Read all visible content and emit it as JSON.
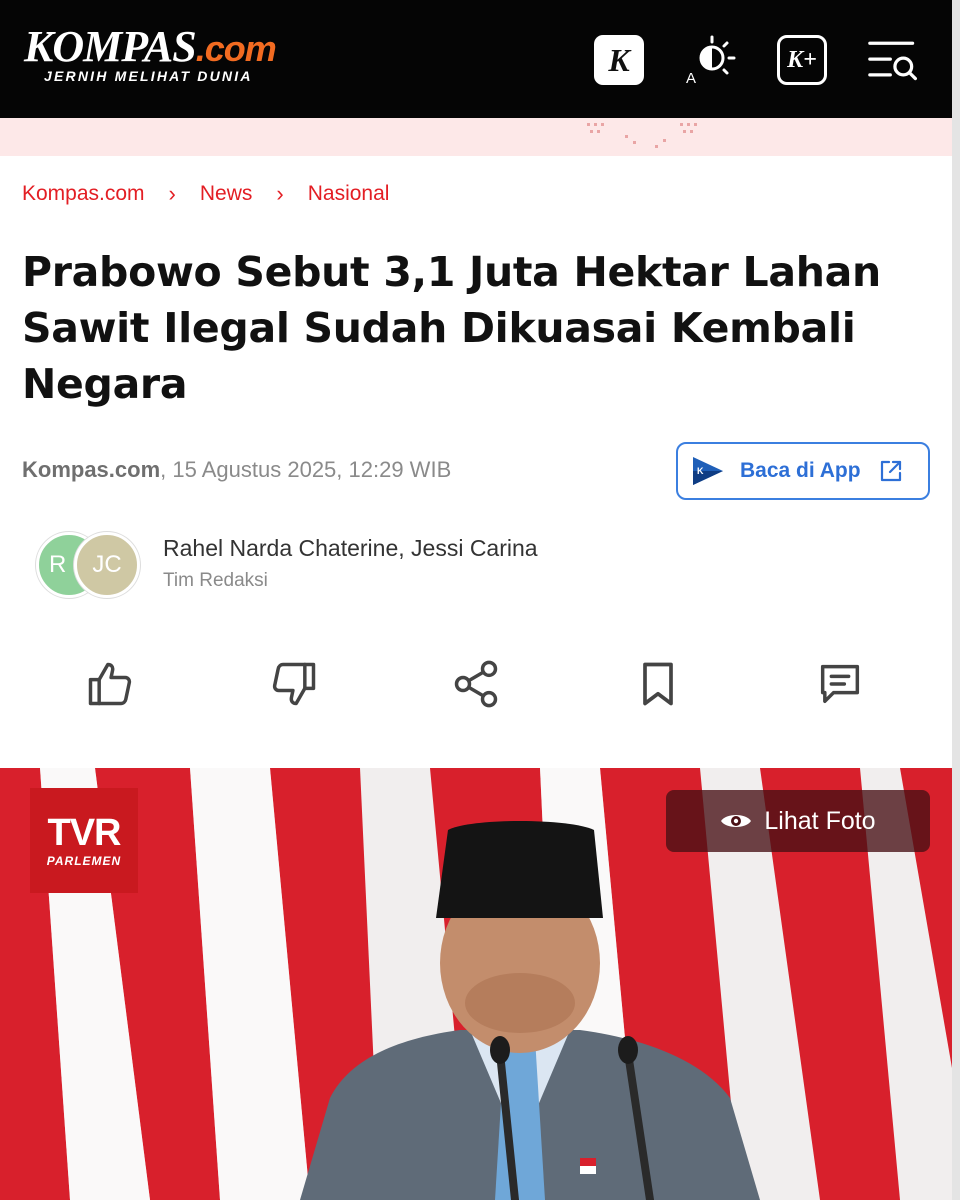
{
  "header": {
    "logo_text": "KOMPAS",
    "logo_suffix": ".com",
    "logo_tagline": "JERNIH MELIHAT DUNIA",
    "k_label": "K",
    "kplus_label": "K+",
    "colors": {
      "bar": "#050505",
      "accent": "#f26b21"
    }
  },
  "breadcrumb": [
    "Kompas.com",
    "News",
    "Nasional"
  ],
  "article": {
    "title": "Prabowo Sebut 3,1 Juta Hektar Lahan Sawit Ilegal Sudah Dikuasai Kembali Negara",
    "source": "Kompas.com",
    "datetime": ", 15 Agustus 2025, 12:29 WIB",
    "app_button_label": "Baca di App",
    "authors": "Rahel Narda Chaterine,  Jessi Carina",
    "team": "Tim Redaksi",
    "avatar_initials": [
      "R",
      "JC"
    ]
  },
  "actions": [
    "like-icon",
    "dislike-icon",
    "share-icon",
    "bookmark-icon",
    "comment-icon"
  ],
  "hero": {
    "badge_main": "TVR",
    "badge_sub": "PARLEMEN",
    "photo_button": "Lihat Foto"
  },
  "colors": {
    "brand_red": "#e31e24",
    "link_blue": "#2d6fd6"
  }
}
